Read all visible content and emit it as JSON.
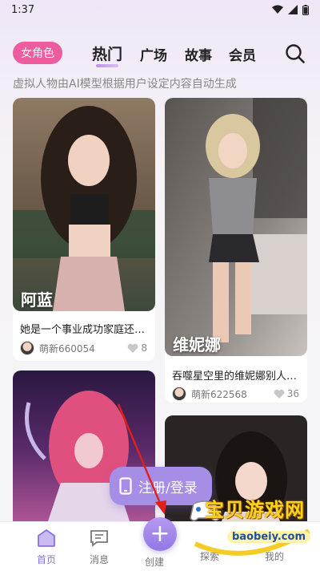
{
  "status_bar": {
    "time": "1:37"
  },
  "header": {
    "role_chip": "女角色",
    "tabs": [
      {
        "label": "热门",
        "active": true
      },
      {
        "label": "广场",
        "active": false
      },
      {
        "label": "故事",
        "active": false
      },
      {
        "label": "会员",
        "active": false
      }
    ],
    "subtitle": "虚拟人物由AI模型根据用户设定内容自动生成"
  },
  "cards": [
    {
      "name": "阿蓝",
      "desc": "她是一个事业成功家庭还…",
      "author": "萌新660054",
      "likes": "8"
    },
    {
      "name": "维妮娜",
      "desc": "吞噬星空里的维妮娜别人…",
      "author": "萌新622568",
      "likes": "36"
    },
    {
      "name": "",
      "desc": "",
      "author": "",
      "likes": ""
    },
    {
      "name": "",
      "desc": "",
      "author": "",
      "likes": ""
    }
  ],
  "register_button": {
    "label": "注册/登录"
  },
  "bottom_nav": [
    {
      "label": "首页",
      "active": true
    },
    {
      "label": "消息",
      "active": false
    },
    {
      "label": "创建",
      "active": false
    },
    {
      "label": "探索",
      "active": false
    },
    {
      "label": "我的",
      "active": false
    }
  ],
  "watermark": {
    "text": "宝贝游戏网",
    "url": "baobeiy.com"
  },
  "colors": {
    "accent": "#a68ee6",
    "chip": "#ec5c9f",
    "nav_active": "#8a6fe0"
  }
}
